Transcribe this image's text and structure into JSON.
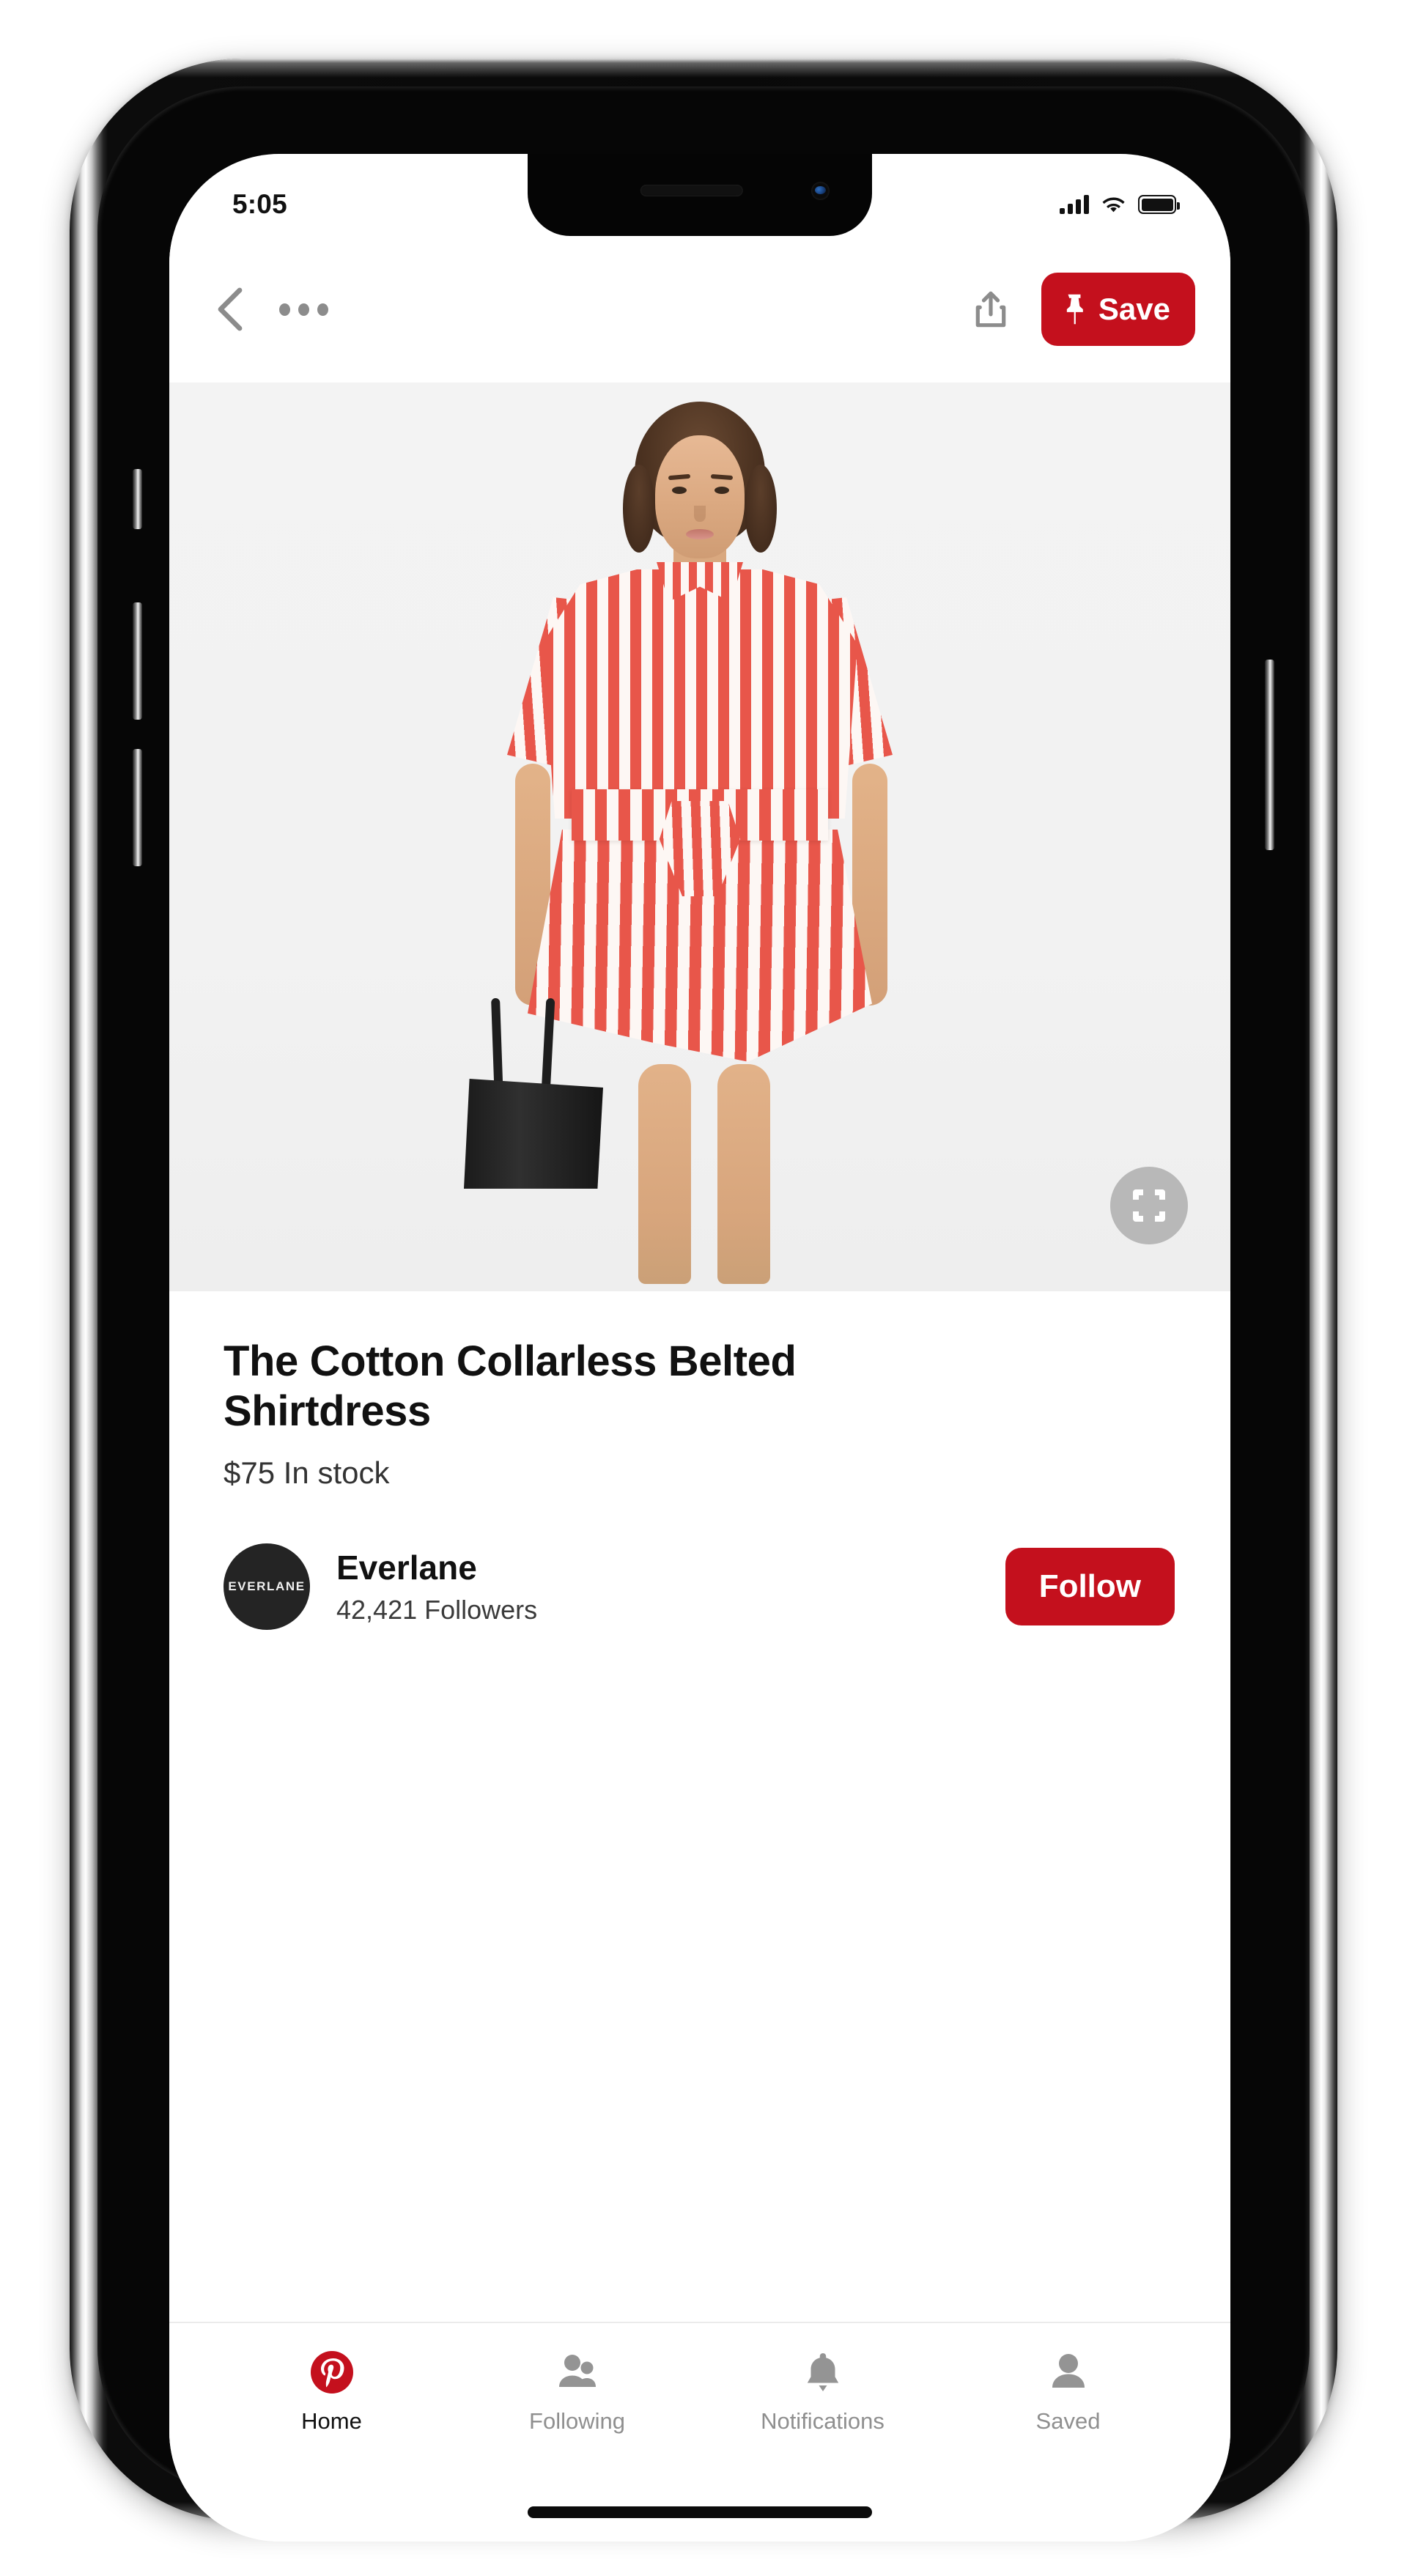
{
  "device": {
    "type": "iphone-x",
    "statusbar": {
      "time": "5:05",
      "signal_icon": "cellular-signal-icon",
      "wifi_icon": "wifi-icon",
      "battery_icon": "battery-full-icon"
    }
  },
  "navbar": {
    "back_icon": "back-chevron-icon",
    "more_icon": "more-options-icon",
    "share_icon": "share-icon",
    "save_label": "Save",
    "save_icon": "pin-icon",
    "save_color": "#c4101d"
  },
  "hero": {
    "alt": "Model wearing red and white striped belted shirtdress holding black tote bag",
    "background_color": "#f2f2f2",
    "stripe_color": "#e8564a",
    "lens_icon": "visual-search-icon"
  },
  "product": {
    "title": "The Cotton Collarless Belted Shirtdress",
    "price_and_stock": "$75 In stock"
  },
  "brand": {
    "avatar_label": "EVERLANE",
    "name": "Everlane",
    "followers": "42,421 Followers",
    "follow_label": "Follow",
    "follow_color": "#c4101d"
  },
  "tabbar": {
    "items": [
      {
        "label": "Home",
        "icon": "pinterest-logo-icon",
        "active": true
      },
      {
        "label": "Following",
        "icon": "people-icon",
        "active": false
      },
      {
        "label": "Notifications",
        "icon": "bell-icon",
        "active": false
      },
      {
        "label": "Saved",
        "icon": "person-icon",
        "active": false
      }
    ]
  }
}
